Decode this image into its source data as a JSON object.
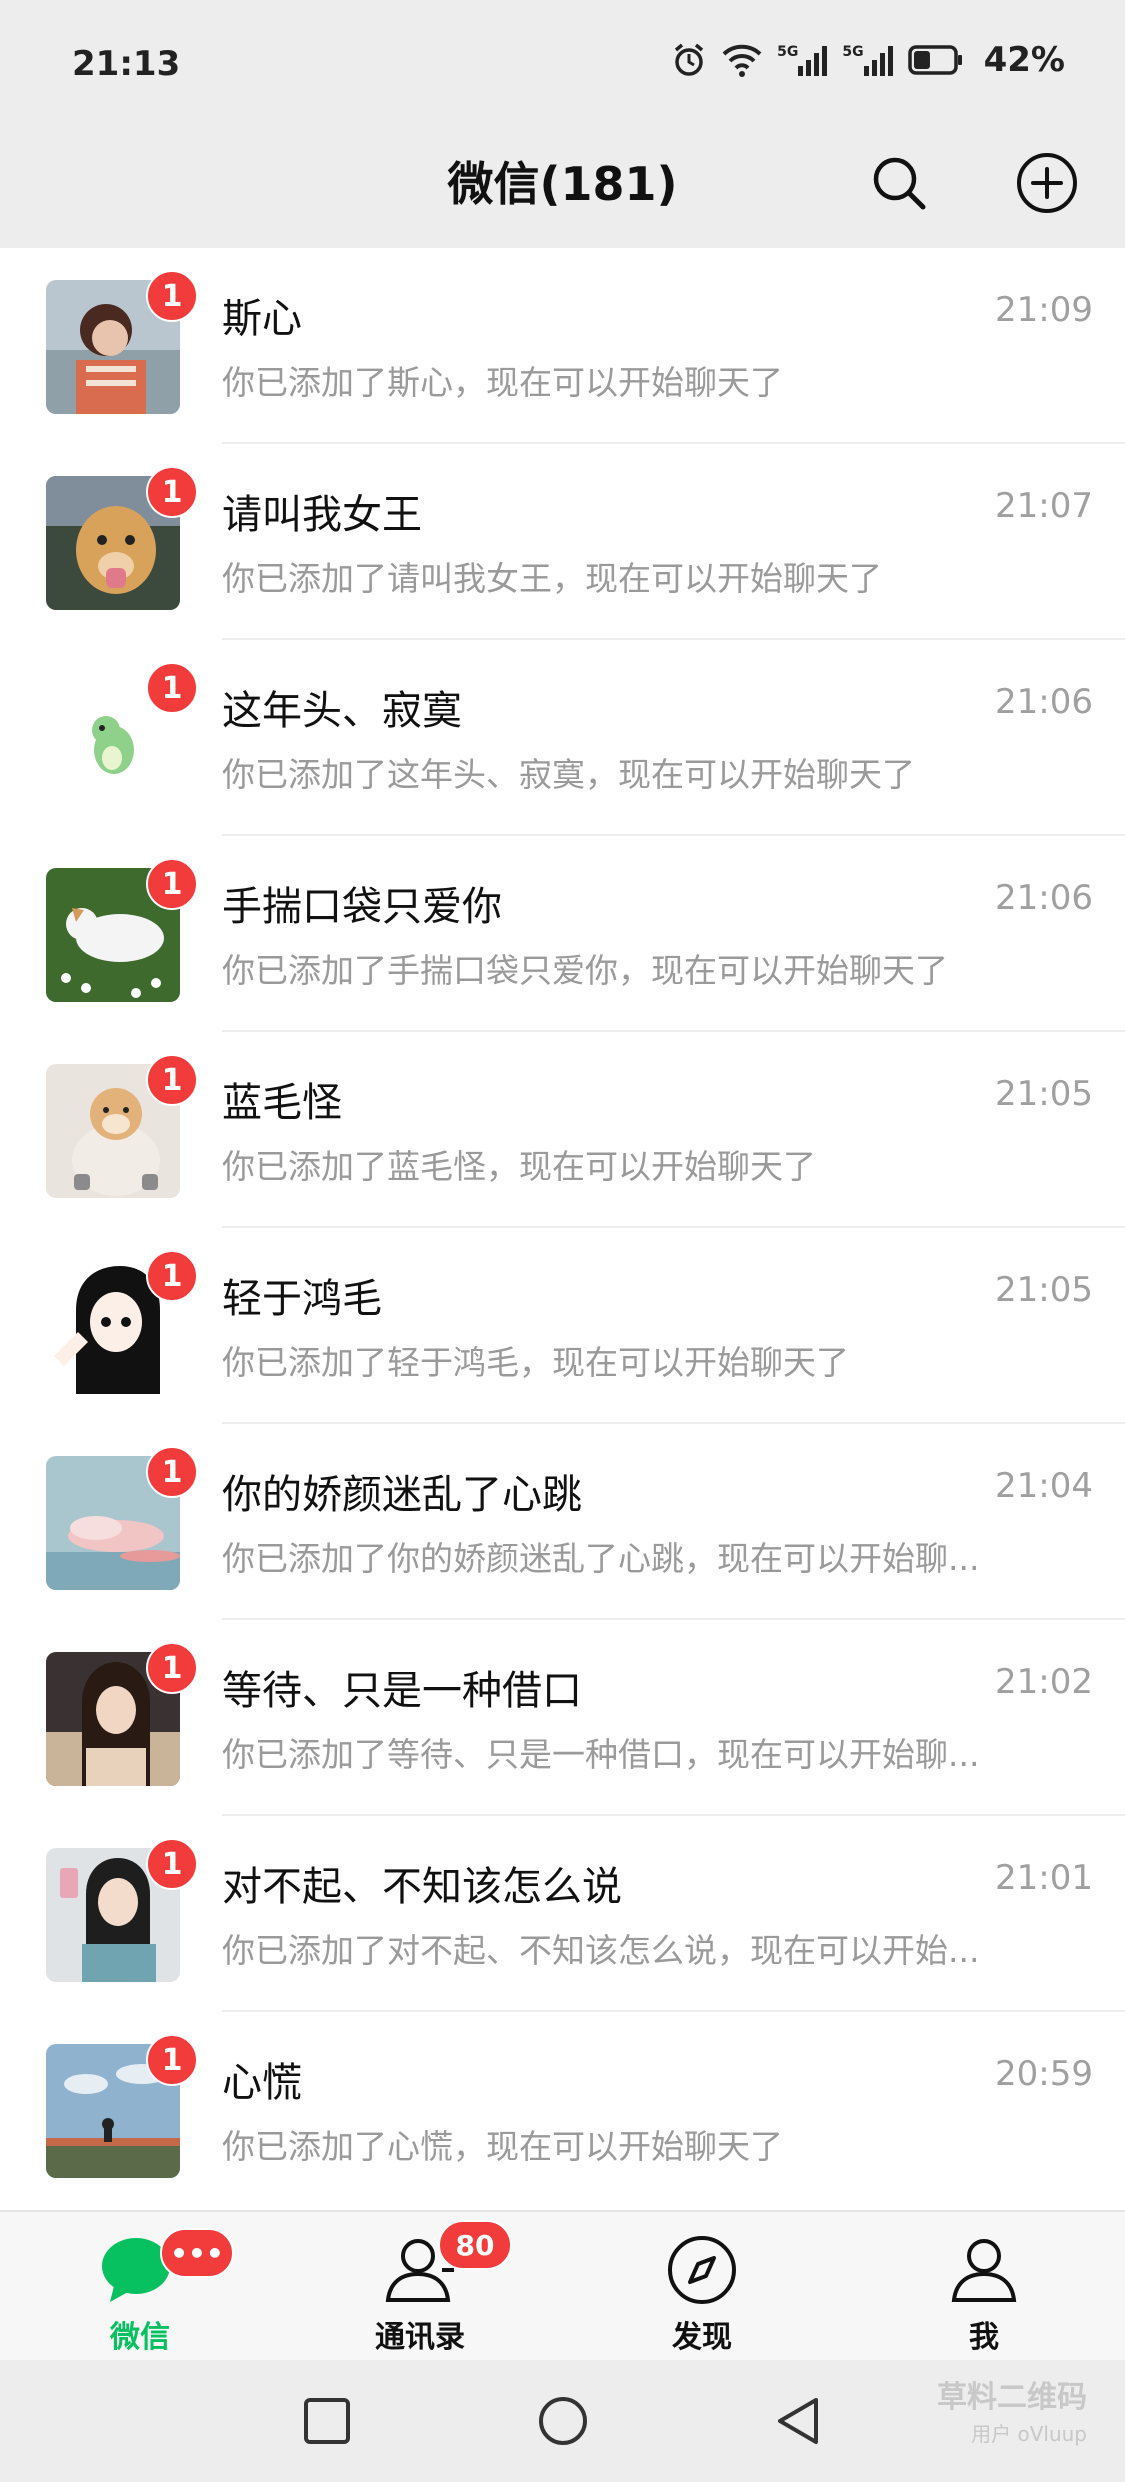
{
  "status": {
    "time": "21:13",
    "net1": "5G",
    "net2": "5G",
    "battery": "42%",
    "battery_level": 0.42
  },
  "header": {
    "title": "微信(181)"
  },
  "chats": [
    {
      "name": "斯心",
      "time": "21:09",
      "preview": "你已添加了斯心，现在可以开始聊天了",
      "unread": "1"
    },
    {
      "name": "请叫我女王",
      "time": "21:07",
      "preview": "你已添加了请叫我女王，现在可以开始聊天了",
      "unread": "1"
    },
    {
      "name": "这年头、寂寞",
      "time": "21:06",
      "preview": "你已添加了这年头、寂寞，现在可以开始聊天了",
      "unread": "1"
    },
    {
      "name": "手揣口袋只爱你",
      "time": "21:06",
      "preview": "你已添加了手揣口袋只爱你，现在可以开始聊天了",
      "unread": "1"
    },
    {
      "name": "蓝毛怪",
      "time": "21:05",
      "preview": "你已添加了蓝毛怪，现在可以开始聊天了",
      "unread": "1"
    },
    {
      "name": "轻于鸿毛",
      "time": "21:05",
      "preview": "你已添加了轻于鸿毛，现在可以开始聊天了",
      "unread": "1"
    },
    {
      "name": "你的娇颜迷乱了心跳",
      "time": "21:04",
      "preview": "你已添加了你的娇颜迷乱了心跳，现在可以开始聊...",
      "unread": "1"
    },
    {
      "name": "等待、只是一种借口",
      "time": "21:02",
      "preview": "你已添加了等待、只是一种借口，现在可以开始聊...",
      "unread": "1"
    },
    {
      "name": "对不起、不知该怎么说",
      "time": "21:01",
      "preview": "你已添加了对不起、不知该怎么说，现在可以开始...",
      "unread": "1"
    },
    {
      "name": "心慌",
      "time": "20:59",
      "preview": "你已添加了心慌，现在可以开始聊天了",
      "unread": "1"
    }
  ],
  "tabs": [
    {
      "label": "微信",
      "icon": "chat-bubble-icon",
      "badge": "•••"
    },
    {
      "label": "通讯录",
      "icon": "contacts-icon",
      "badge": "80"
    },
    {
      "label": "发现",
      "icon": "compass-icon",
      "badge": ""
    },
    {
      "label": "我",
      "icon": "person-icon",
      "badge": ""
    }
  ],
  "watermark": {
    "line1": "草料二维码",
    "line2": "用户 oVluup"
  },
  "colors": {
    "accent": "#07c160",
    "badge": "#f23c3c",
    "background": "#ededed"
  }
}
